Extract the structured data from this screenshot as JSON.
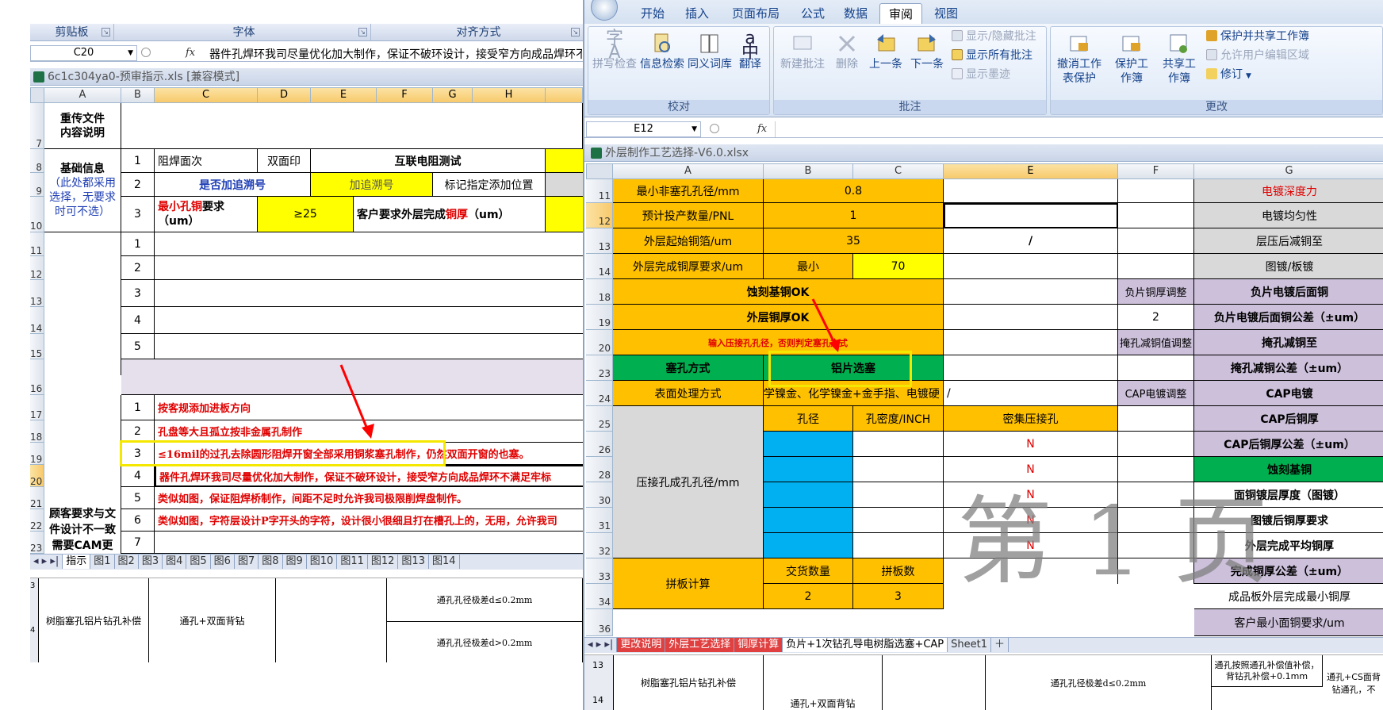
{
  "left": {
    "ribbon_groups": [
      "剪贴板",
      "字体",
      "对齐方式"
    ],
    "namebox": "C20",
    "fx": "fx",
    "formula": "器件孔焊环我司尽量优化加大制作，保证不破环设计，接受窄方向成品焊环不满足",
    "title": "6c1c304ya0-预审指示.xls  [兼容模式]",
    "col_headers": [
      "A",
      "B",
      "C",
      "D",
      "E",
      "F",
      "G",
      "H"
    ],
    "row_headers": [
      "7",
      "8",
      "9",
      "10",
      "11",
      "12",
      "13",
      "14",
      "15",
      "16",
      "17",
      "18",
      "19",
      "20",
      "21",
      "22",
      "23"
    ],
    "a_reupload": "重传文件\n内容说明",
    "a_basic_title": "基础信息",
    "a_basic_note": "（此处都采用选择，无要求时可不选）",
    "a_customer": "顾客要求与文件设计不一致需要CAM更",
    "nums": [
      "1",
      "2",
      "3",
      "1",
      "2",
      "3",
      "4",
      "5",
      "1",
      "2",
      "3",
      "4",
      "5",
      "6",
      "7"
    ],
    "r8_c": "阻焊面次",
    "r8_d": "双面印",
    "r8_e": "互联电阻测试",
    "r9_c": "是否加追溯号",
    "r9_e": "加追溯号",
    "r9_g": "标记指定添加位置",
    "r10_c1": "最小孔铜",
    "r10_c2": "要求",
    "r10_c3": "（um）",
    "r10_d": "≥25",
    "r10_f1": "客户要求外层完成",
    "r10_f2": "铜厚",
    "r10_f3": "（um）",
    "instr": [
      "按客规添加进板方向",
      "孔盘等大且孤立按非金属孔制作",
      "≤16mil的过孔去除圆形阻焊开窗全部采用铜浆塞孔制作，仍然双面开窗的也塞。",
      "器件孔焊环我司尽量优化加大制作，保证不破环设计，接受窄方向成品焊环不满足牢标",
      "类似如图，保证阻焊桥制作，间距不足时允许我司极限削焊盘制作。",
      "类似如图，字符层设计P字开头的字符，设计很小很细且打在槽孔上的，无用，允许我司"
    ],
    "tabs": [
      "指示",
      "图1",
      "图2",
      "图3",
      "图4",
      "图5",
      "图6",
      "图7",
      "图8",
      "图9",
      "图10",
      "图11",
      "图12",
      "图13",
      "图14"
    ],
    "bottom": {
      "row_a": "3",
      "row_b": "4",
      "c1": "树脂塞孔铝片钻孔补偿",
      "c2": "通孔+双面背钻",
      "c3": "通孔孔径极差d≤0.2mm",
      "c4": "通孔孔径极差d>0.2mm"
    }
  },
  "right": {
    "tabs": [
      "开始",
      "插入",
      "页面布局",
      "公式",
      "数据",
      "审阅",
      "视图"
    ],
    "active_tab": "审阅",
    "groups": {
      "proof": {
        "label": "校对",
        "buttons": [
          "拼写检查",
          "信息检索",
          "同义词库",
          "翻译"
        ]
      },
      "comments": {
        "label": "批注",
        "buttons": [
          "新建批注",
          "删除",
          "上一条",
          "下一条"
        ],
        "small": [
          "显示/隐藏批注",
          "显示所有批注",
          "显示墨迹"
        ]
      },
      "changes": {
        "label": "更改",
        "buttons": [
          "撤消工作表保护",
          "保护工作簿",
          "共享工作簿"
        ],
        "small": [
          "保护并共享工作簿",
          "允许用户编辑区域",
          "修订"
        ]
      }
    },
    "namebox": "E12",
    "fx": "fx",
    "title": "外层制作工艺选择-V6.0.xlsx",
    "col_headers": [
      "A",
      "B",
      "C",
      "E",
      "F",
      "G"
    ],
    "row_headers": [
      "11",
      "12",
      "13",
      "14",
      "18",
      "19",
      "20",
      "23",
      "24",
      "25",
      "26",
      "28",
      "30",
      "31",
      "32",
      "33",
      "34",
      "36"
    ],
    "cells": {
      "r11_a": "最小非塞孔孔径/mm",
      "r11_b": "0.8",
      "r11_g": "电镀深度力",
      "r12_a": "预计投产数量/PNL",
      "r12_b": "1",
      "r12_g": "电镀均匀性",
      "r13_a": "外层起始铜箔/um",
      "r13_b": "35",
      "r13_e": "/",
      "r13_g": "层压后减铜至",
      "r14_a": "外层完成铜厚要求/um",
      "r14_b": "最小",
      "r14_c": "70",
      "r14_g": "图镀/板镀",
      "r18_a": "蚀刻基铜OK",
      "r18_f": "负片铜厚调整",
      "r18_g": "负片电镀后面铜",
      "r19_a": "外层铜厚OK",
      "r19_f": "2",
      "r19_g": "负片电镀后面铜公差（±um）",
      "r20_a": "输入压接孔孔径，否则判定塞孔方式",
      "r20_f": "掩孔减铜值调整",
      "r20_g": "掩孔减铜至",
      "r23_a": "塞孔方式",
      "r23_b": "铝片选塞",
      "r23_g": "掩孔减铜公差（±um）",
      "r24_a": "表面处理方式",
      "r24_b": "学镍金、化学镍金+金手指、电镀硬",
      "r24_e": "/",
      "r24_f": "CAP电镀调整",
      "r24_g": "CAP电镀",
      "r25_b": "孔径",
      "r25_c": "孔密度/INCH",
      "r25_e": "密集压接孔",
      "r25_g": "CAP后铜厚",
      "r26_g": "CAP后铜厚公差（±um）",
      "press_a": "压接孔成孔孔径/mm",
      "n_vals": [
        "N",
        "N",
        "N",
        "N",
        "N"
      ],
      "r28_g": "蚀刻基铜",
      "r30_g": "面铜镀层厚度（图镀）",
      "r31_g": "图镀后铜厚要求",
      "r32_g": "外层完成平均铜厚",
      "r33_a": "拼板计算",
      "r33_b": "交货数量",
      "r33_c": "拼板数",
      "r33_g": "完成铜厚公差（±um）",
      "r34_b": "2",
      "r34_c": "3",
      "r34_g": "成品板外层完成最小铜厚",
      "r36_g": "客户最小面铜要求/um"
    },
    "watermark": "第 1 页",
    "sheet_tabs": [
      "更改说明",
      "外层工艺选择",
      "铜厚计算",
      "负片+1次钻孔导电树脂选塞+CAP",
      "Sheet1"
    ],
    "active_sheet": "负片+1次钻孔导电树脂选塞+CAP",
    "bottom": {
      "row_a": "13",
      "row_b": "14",
      "c1": "树脂塞孔铝片钻孔补偿",
      "c2": "通孔+双面背钻",
      "c3": "通孔孔径极差d≤0.2mm",
      "c4": "通孔按照通孔补偿值补偿，背钻孔补偿+0.1mm",
      "c5": "通孔+CS面背钻通孔，不"
    }
  },
  "colors": {
    "yellow": "#ffff00",
    "orange": "#ffc000",
    "green": "#00b050",
    "blue": "#00b0f0",
    "lavender": "#ccc0da",
    "highlight": "#f5e800",
    "arrow": "#ff0000"
  }
}
